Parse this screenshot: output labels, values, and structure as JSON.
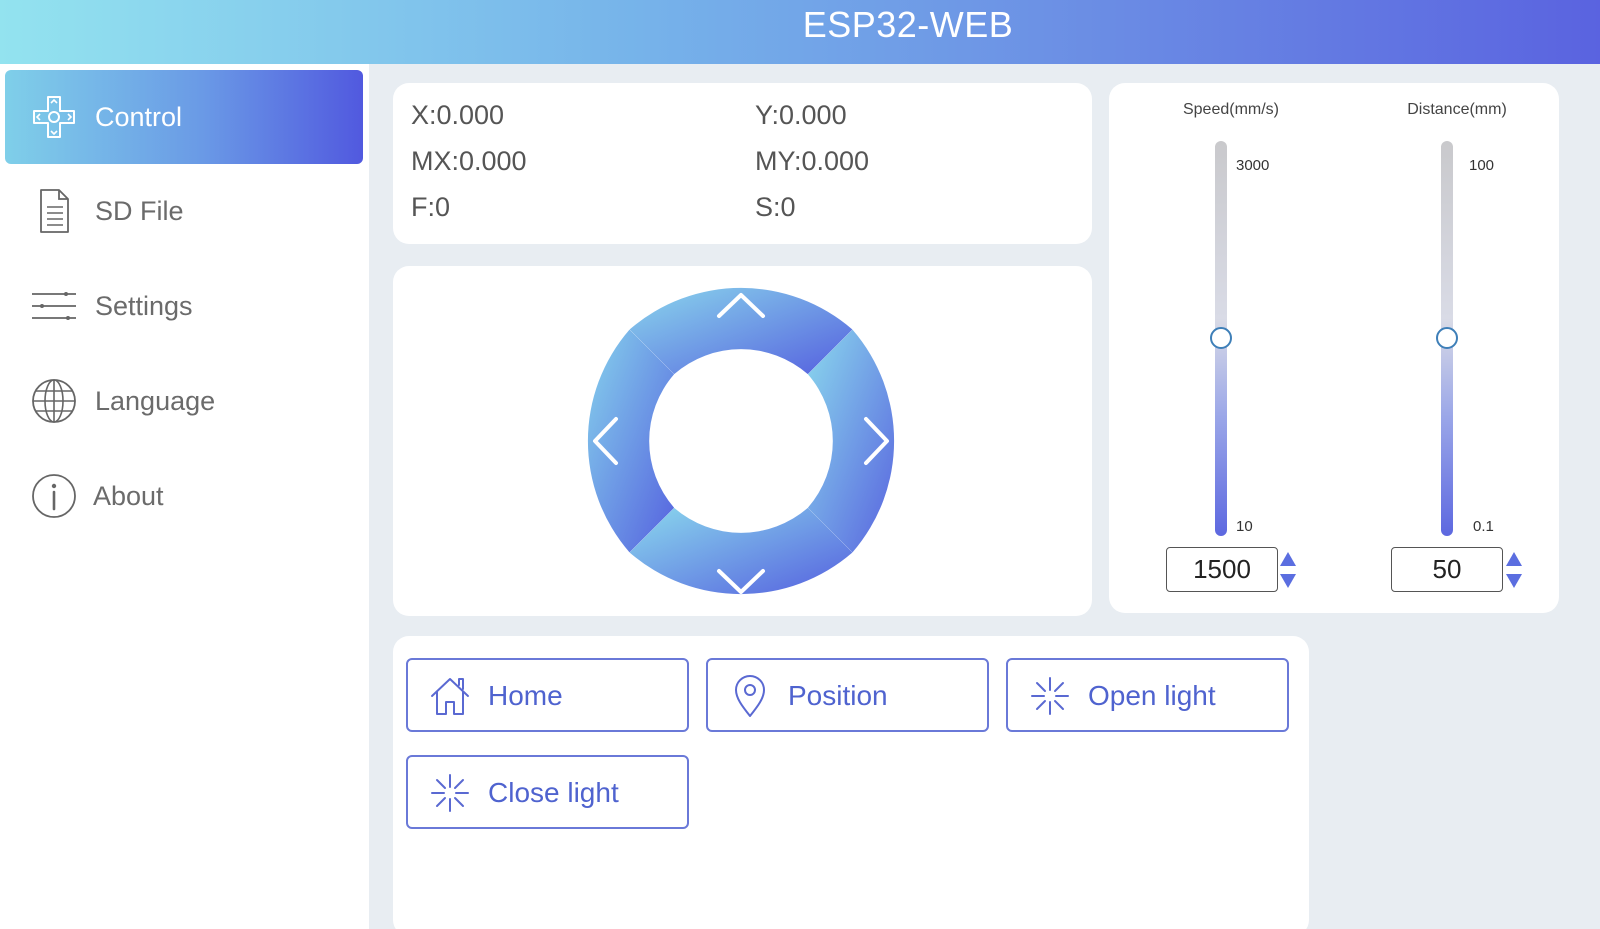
{
  "app": {
    "title": "ESP32-WEB"
  },
  "sidebar": {
    "items": [
      {
        "label": "Control",
        "icon": "dpad-icon",
        "active": true
      },
      {
        "label": "SD File",
        "icon": "file-icon",
        "active": false
      },
      {
        "label": "Settings",
        "icon": "sliders-icon",
        "active": false
      },
      {
        "label": "Language",
        "icon": "globe-icon",
        "active": false
      },
      {
        "label": "About",
        "icon": "info-icon",
        "active": false
      }
    ]
  },
  "coords": {
    "x": "X:0.000",
    "y": "Y:0.000",
    "mx": "MX:0.000",
    "my": "MY:0.000",
    "f": "F:0",
    "s": "S:0"
  },
  "jog": {
    "up": "chevron-up-icon",
    "down": "chevron-down-icon",
    "left": "chevron-left-icon",
    "right": "chevron-right-icon"
  },
  "speed": {
    "title": "Speed(mm/s)",
    "max": "3000",
    "min": "10",
    "value": "1500"
  },
  "distance": {
    "title": "Distance(mm)",
    "max": "100",
    "min": "0.1",
    "value": "50"
  },
  "actions": [
    {
      "label": "Home",
      "icon": "home-icon"
    },
    {
      "label": "Position",
      "icon": "location-pin-icon"
    },
    {
      "label": "Open light",
      "icon": "sparkle-icon"
    },
    {
      "label": "Close light",
      "icon": "sparkle-icon"
    }
  ],
  "colors": {
    "accent": "#5a63e0",
    "accent_light": "#93e3ef",
    "button_border": "#6a79d8",
    "button_text": "#4f63cf"
  }
}
